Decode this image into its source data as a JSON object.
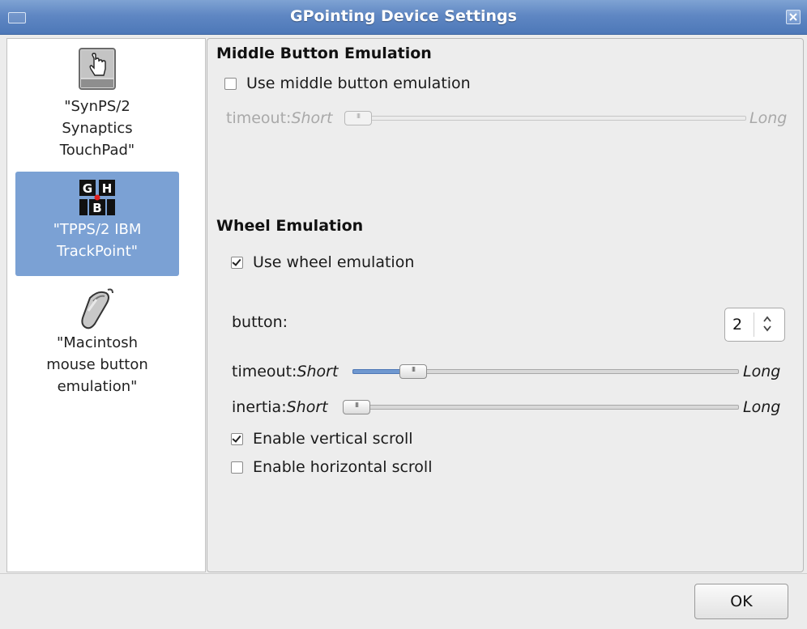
{
  "window": {
    "title": "GPointing Device Settings"
  },
  "devices": [
    {
      "label_lines": [
        "\"SynPS/2",
        "Synaptics",
        "TouchPad\""
      ],
      "icon": "touchpad-hand-icon",
      "selected": false
    },
    {
      "label_lines": [
        "\"TPPS/2 IBM",
        "TrackPoint\""
      ],
      "icon": "trackpoint-ghb-icon",
      "icon_letters": [
        "G",
        "H",
        "B"
      ],
      "selected": true
    },
    {
      "label_lines": [
        "\"Macintosh",
        "mouse button",
        "emulation\""
      ],
      "icon": "mouse-icon",
      "selected": false
    }
  ],
  "middle_button": {
    "title": "Middle Button Emulation",
    "checkbox_label": "Use middle button emulation",
    "checked": false,
    "timeout": {
      "label": "timeout:",
      "min_label": "Short",
      "max_label": "Long",
      "value": 0.0
    }
  },
  "wheel": {
    "title": "Wheel Emulation",
    "checkbox_label": "Use wheel emulation",
    "checked": true,
    "button_label": "button:",
    "button_value": "2",
    "timeout": {
      "label": "timeout:",
      "min_label": "Short",
      "max_label": "Long",
      "value": 0.13
    },
    "inertia": {
      "label": "inertia:",
      "min_label": "Short",
      "max_label": "Long",
      "value": 0.0
    },
    "vertical_label": "Enable vertical scroll",
    "vertical_checked": true,
    "horizontal_label": "Enable horizontal scroll",
    "horizontal_checked": false
  },
  "ok_label": "OK",
  "colors": {
    "titlebar": "#5f87c3",
    "selection": "#7ba1d4",
    "slider_fill": "#6f98d0"
  }
}
